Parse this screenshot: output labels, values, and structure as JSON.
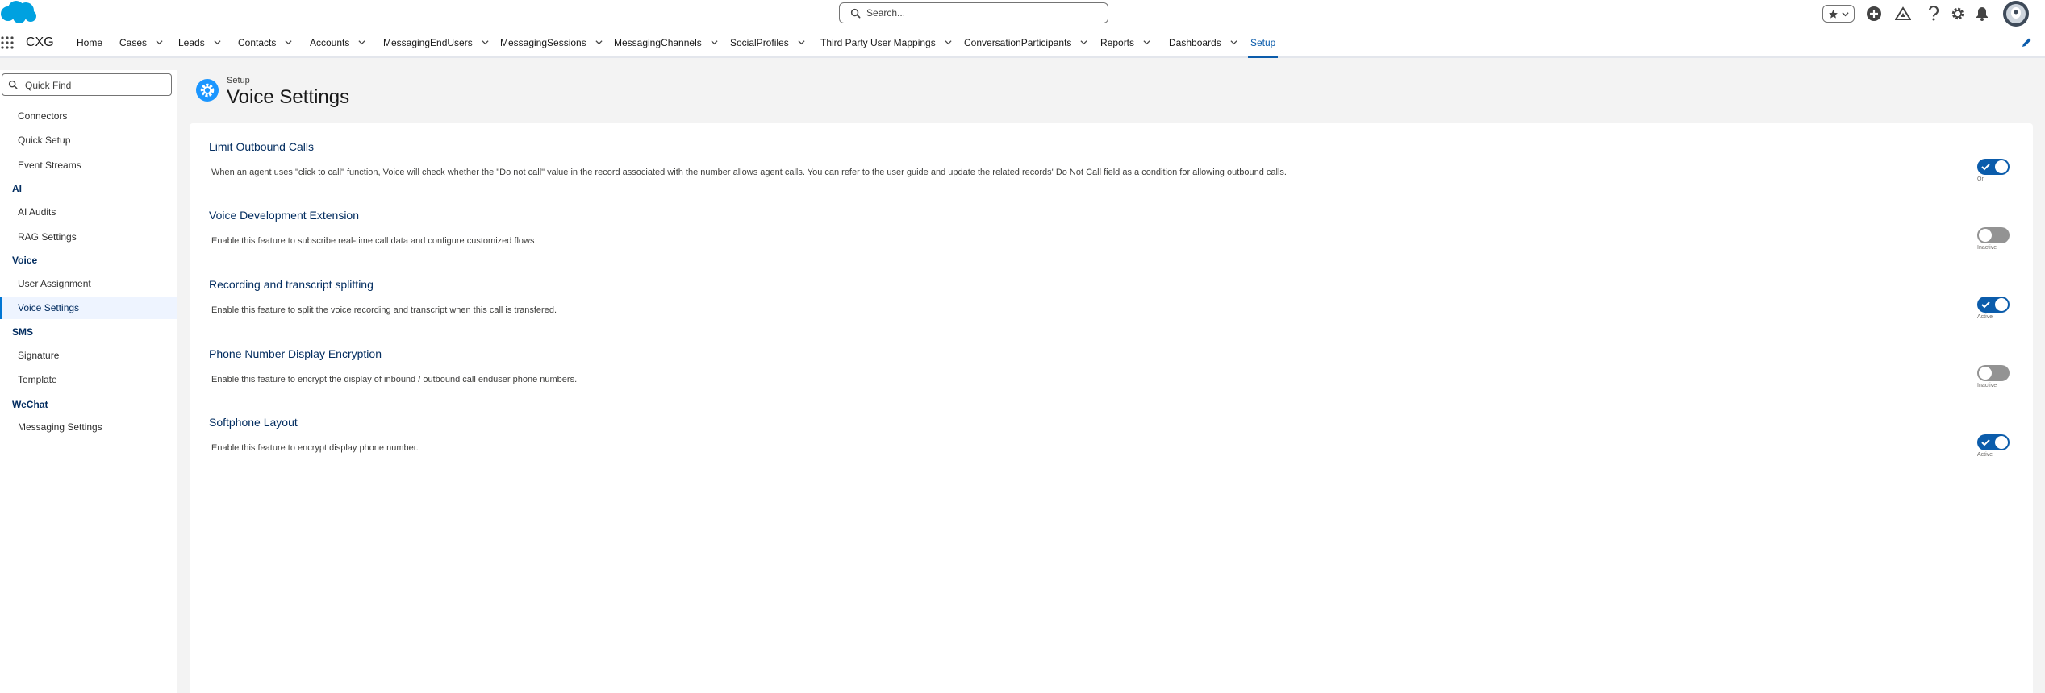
{
  "header": {
    "search_placeholder": "Search...",
    "brand_color": "#00a1e0"
  },
  "nav": {
    "app_name": "CXG",
    "items": [
      {
        "label": "Home",
        "has_menu": false
      },
      {
        "label": "Cases",
        "has_menu": true
      },
      {
        "label": "Leads",
        "has_menu": true
      },
      {
        "label": "Contacts",
        "has_menu": true
      },
      {
        "label": "Accounts",
        "has_menu": true
      },
      {
        "label": "MessagingEndUsers",
        "has_menu": true
      },
      {
        "label": "MessagingSessions",
        "has_menu": true
      },
      {
        "label": "MessagingChannels",
        "has_menu": true
      },
      {
        "label": "SocialProfiles",
        "has_menu": true
      },
      {
        "label": "Third Party User Mappings",
        "has_menu": true
      },
      {
        "label": "ConversationParticipants",
        "has_menu": true
      },
      {
        "label": "Reports",
        "has_menu": true
      },
      {
        "label": "Dashboards",
        "has_menu": true
      },
      {
        "label": "Setup",
        "has_menu": false,
        "active": true
      }
    ]
  },
  "sidebar": {
    "quick_find_placeholder": "Quick Find",
    "items": [
      {
        "type": "item",
        "label": "Connectors"
      },
      {
        "type": "item",
        "label": "Quick Setup"
      },
      {
        "type": "item",
        "label": "Event Streams"
      },
      {
        "type": "group",
        "label": "AI"
      },
      {
        "type": "item",
        "label": "AI Audits"
      },
      {
        "type": "item",
        "label": "RAG Settings"
      },
      {
        "type": "group",
        "label": "Voice"
      },
      {
        "type": "item",
        "label": "User Assignment"
      },
      {
        "type": "item",
        "label": "Voice Settings",
        "selected": true
      },
      {
        "type": "group",
        "label": "SMS"
      },
      {
        "type": "item",
        "label": "Signature"
      },
      {
        "type": "item",
        "label": "Template"
      },
      {
        "type": "group",
        "label": "WeChat"
      },
      {
        "type": "item",
        "label": "Messaging Settings"
      }
    ]
  },
  "page": {
    "overline": "Setup",
    "title": "Voice Settings"
  },
  "settings": [
    {
      "title": "Limit Outbound Calls",
      "description": "When an agent uses \"click to call\" function, Voice will check whether the \"Do not call\" value in the record associated with the number allows agent calls. You can refer to the user guide and update the related records' Do Not Call field as a condition for allowing outbound calls.",
      "enabled": true,
      "status_label": "On"
    },
    {
      "title": "Voice Development Extension",
      "description": "Enable this feature to subscribe real-time call data and configure customized flows",
      "enabled": false,
      "status_label": "Inactive"
    },
    {
      "title": "Recording and transcript splitting",
      "description": "Enable this feature to split the voice recording and transcript when this call is transfered.",
      "enabled": true,
      "status_label": "Active"
    },
    {
      "title": "Phone Number Display Encryption",
      "description": "Enable this feature to encrypt the display of inbound / outbound call enduser phone numbers.",
      "enabled": false,
      "status_label": "Inactive"
    },
    {
      "title": "Softphone Layout",
      "description": "Enable this feature to encrypt display phone number.",
      "enabled": true,
      "status_label": "Active"
    }
  ]
}
